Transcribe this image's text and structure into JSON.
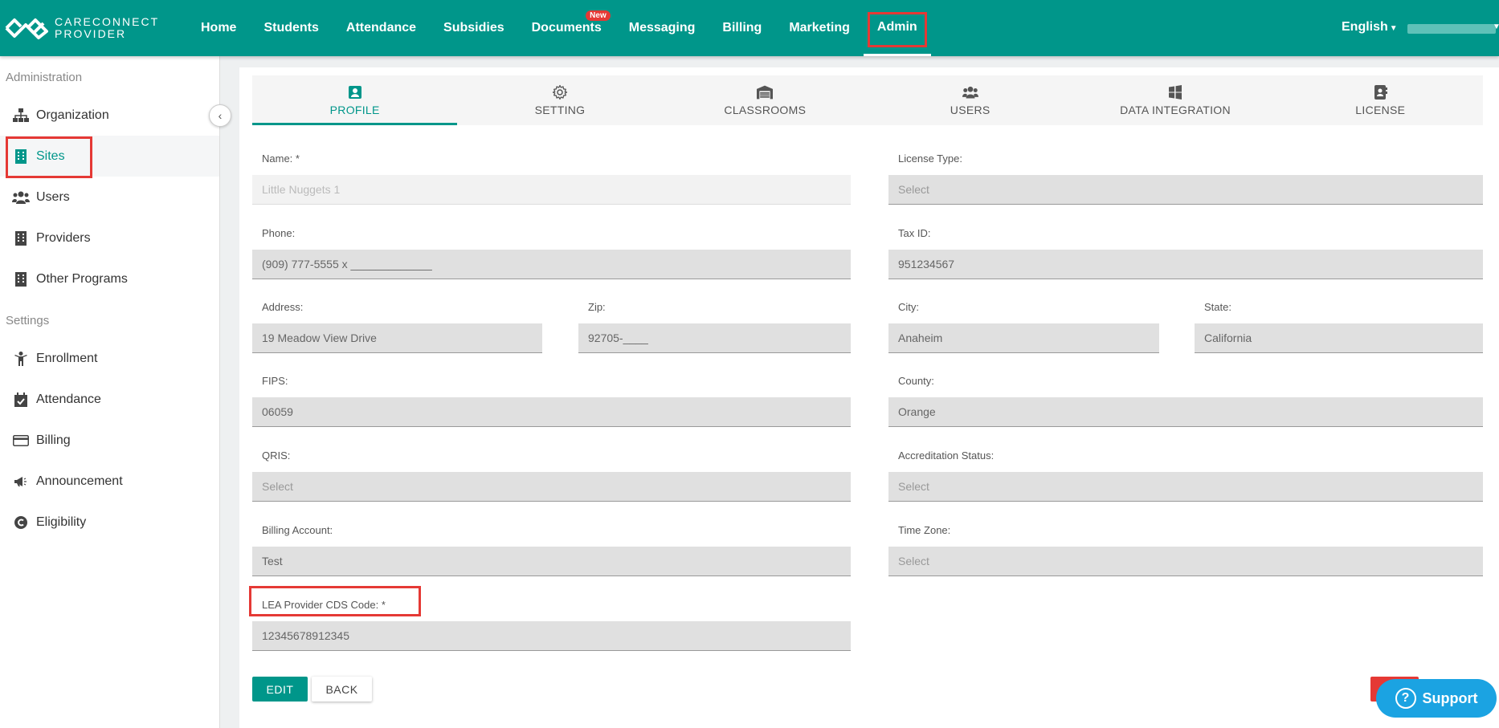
{
  "brand": {
    "line1": "CARECONNECT",
    "line2": "PROVIDER"
  },
  "nav": {
    "items": [
      {
        "label": "Home"
      },
      {
        "label": "Students"
      },
      {
        "label": "Attendance"
      },
      {
        "label": "Subsidies"
      },
      {
        "label": "Documents",
        "badge": "New"
      },
      {
        "label": "Messaging"
      },
      {
        "label": "Billing"
      },
      {
        "label": "Marketing"
      },
      {
        "label": "Admin",
        "active": true
      }
    ]
  },
  "language": "English",
  "sidebar": {
    "sections": [
      {
        "header": "Administration",
        "items": [
          "Organization",
          "Sites",
          "Users",
          "Providers",
          "Other Programs"
        ]
      },
      {
        "header": "Settings",
        "items": [
          "Enrollment",
          "Attendance",
          "Billing",
          "Announcement",
          "Eligibility"
        ]
      }
    ],
    "active": "Sites"
  },
  "tabs": [
    "PROFILE",
    "SETTING",
    "CLASSROOMS",
    "USERS",
    "DATA INTEGRATION",
    "LICENSE"
  ],
  "form": {
    "name": {
      "label": "Name: *",
      "value": "Little Nuggets 1"
    },
    "license_type": {
      "label": "License Type:",
      "value": "Select"
    },
    "phone": {
      "label": "Phone:",
      "value": "(909) 777-5555 x _____________"
    },
    "tax_id": {
      "label": "Tax ID:",
      "value": "951234567"
    },
    "address": {
      "label": "Address:",
      "value": "19 Meadow View Drive"
    },
    "zip": {
      "label": "Zip:",
      "value": "92705-____"
    },
    "city": {
      "label": "City:",
      "value": "Anaheim"
    },
    "state": {
      "label": "State:",
      "value": "California"
    },
    "fips": {
      "label": "FIPS:",
      "value": "06059"
    },
    "county": {
      "label": "County:",
      "value": "Orange"
    },
    "qris": {
      "label": "QRIS:",
      "value": "Select"
    },
    "accreditation": {
      "label": "Accreditation Status:",
      "value": "Select"
    },
    "billing_account": {
      "label": "Billing Account:",
      "value": "Test"
    },
    "time_zone": {
      "label": "Time Zone:",
      "value": "Select"
    },
    "lea_code": {
      "label": "LEA Provider CDS Code: *",
      "value": "12345678912345"
    }
  },
  "buttons": {
    "edit": "EDIT",
    "back": "BACK"
  },
  "support": "Support"
}
